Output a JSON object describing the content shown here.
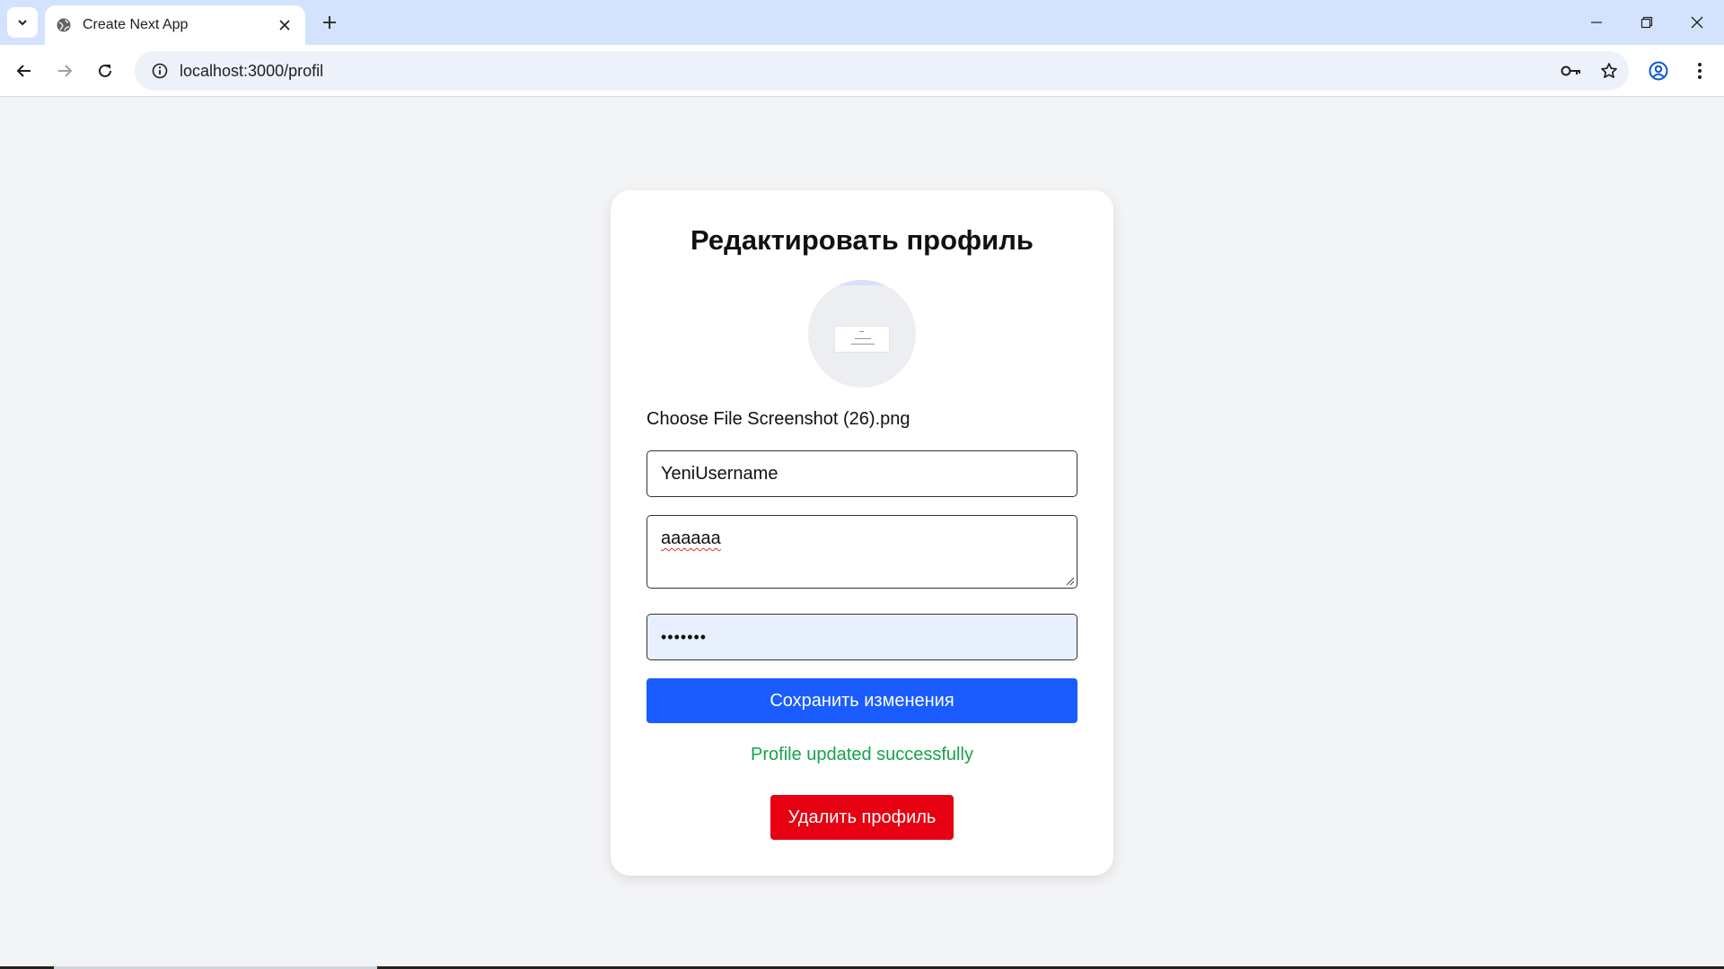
{
  "browser": {
    "tab_title": "Create Next App",
    "url": "localhost:3000/profil",
    "icons": {
      "tab_search": "chevron-down-icon",
      "favicon": "globe-icon",
      "tab_close": "close-icon",
      "new_tab": "plus-icon",
      "minimize": "minimize-icon",
      "restore": "restore-icon",
      "close": "close-icon",
      "back": "arrow-left-icon",
      "forward": "arrow-right-icon",
      "reload": "reload-icon",
      "site_info": "info-icon",
      "password": "key-icon",
      "bookmark": "star-icon",
      "profile": "account-circle-icon",
      "menu": "more-vertical-icon"
    }
  },
  "page": {
    "title": "Редактировать профиль",
    "file_input": {
      "button_label": "Choose File",
      "file_name": "Screenshot (26).png"
    },
    "username_value": "YeniUsername",
    "bio_value": "aaaaaa",
    "password_value": "•••••••",
    "save_label": "Сохранить изменения",
    "status_message": "Profile updated successfully",
    "delete_label": "Удалить профиль"
  },
  "colors": {
    "page_background": "#f3f4f6",
    "save_button": "#1a5cff",
    "delete_button": "#e60012",
    "success_text": "#16a34a",
    "autofill_background": "#e8f0fe"
  }
}
